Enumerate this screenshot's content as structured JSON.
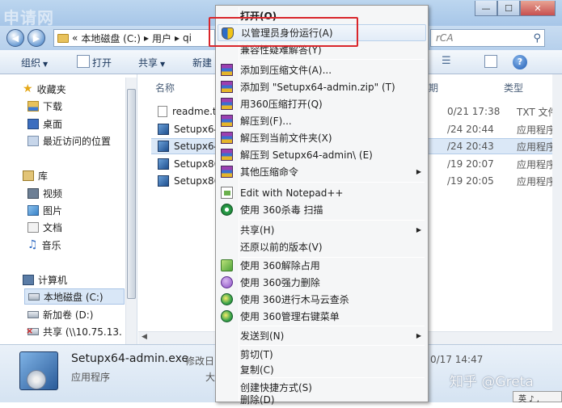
{
  "window": {
    "watermark_top": "申请网",
    "buttons": {
      "minimize": "—",
      "maximize": "☐",
      "close": "✕"
    }
  },
  "address": {
    "back": "◀",
    "forward": "▶",
    "chevrons": "«",
    "crumbs": [
      "本地磁盘 (C:)",
      "用户",
      "qi"
    ],
    "separator": "▸",
    "search_placeholder": "rCA",
    "search_icon": "search-icon"
  },
  "toolbar": {
    "organize": "组织",
    "open": "打开",
    "share": "共享",
    "new_folder": "新建"
  },
  "nav": {
    "favorites": "收藏夹",
    "downloads": "下载",
    "desktop": "桌面",
    "recent": "最近访问的位置",
    "libraries": "库",
    "videos": "视频",
    "pictures": "图片",
    "documents": "文档",
    "music": "音乐",
    "computer": "计算机",
    "drive_c": "本地磁盘 (C:)",
    "drive_d": "新加卷 (D:)",
    "net_share": "共享 (\\\\10.75.13."
  },
  "files": {
    "header_name": "名称",
    "header_date": "期",
    "header_type": "类型",
    "rows": [
      {
        "name": "readme.t",
        "date": "0/21 17:38",
        "type": "TXT 文件"
      },
      {
        "name": "Setupx64",
        "date": "/24 20:44",
        "type": "应用程序"
      },
      {
        "name": "Setupx64",
        "date": "/24 20:43",
        "type": "应用程序"
      },
      {
        "name": "Setupx86",
        "date": "/19 20:07",
        "type": "应用程序"
      },
      {
        "name": "Setupx86",
        "date": "/19 20:05",
        "type": "应用程序"
      }
    ]
  },
  "details": {
    "name": "Setupx64-admin.exe",
    "modified_label": "修改日",
    "type": "应用程序",
    "size_label": "大",
    "date": "0/17 14:47"
  },
  "watermark": "知乎 @Greta",
  "ime": "英 ♪ ,",
  "context_menu": {
    "items": [
      {
        "label": "打开(O)",
        "bold": true
      },
      {
        "label": "以管理员身份运行(A)",
        "icon": "shield-icon",
        "highlight": true
      },
      {
        "label": "兼容性疑难解答(Y)"
      },
      {
        "label": "添加到压缩文件(A)...",
        "icon": "winrar-icon"
      },
      {
        "label": "添加到 \"Setupx64-admin.zip\" (T)",
        "icon": "winrar-icon"
      },
      {
        "label": "用360压缩打开(Q)",
        "icon": "winrar-icon"
      },
      {
        "label": "解压到(F)...",
        "icon": "winrar-icon"
      },
      {
        "label": "解压到当前文件夹(X)",
        "icon": "winrar-icon"
      },
      {
        "label": "解压到 Setupx64-admin\\ (E)",
        "icon": "winrar-icon"
      },
      {
        "label": "其他压缩命令",
        "icon": "winrar-icon",
        "submenu": true
      },
      {
        "label": "Edit with Notepad++",
        "icon": "notepad-icon"
      },
      {
        "label": "使用 360杀毒 扫描",
        "icon": "360-antivirus-icon"
      },
      {
        "label": "共享(H)",
        "submenu": true
      },
      {
        "label": "还原以前的版本(V)"
      },
      {
        "label": "使用 360解除占用",
        "icon": "360-unlock-icon"
      },
      {
        "label": "使用 360强力删除",
        "icon": "360-delete-icon"
      },
      {
        "label": "使用 360进行木马云查杀",
        "icon": "360-cloud-scan-icon"
      },
      {
        "label": "使用 360管理右键菜单",
        "icon": "360-menu-icon"
      },
      {
        "label": "发送到(N)",
        "submenu": true
      },
      {
        "label": "剪切(T)"
      },
      {
        "label": "复制(C)"
      },
      {
        "label": "创建快捷方式(S)"
      },
      {
        "label": "删除(D)"
      }
    ],
    "submenu_arrow": "▶"
  }
}
